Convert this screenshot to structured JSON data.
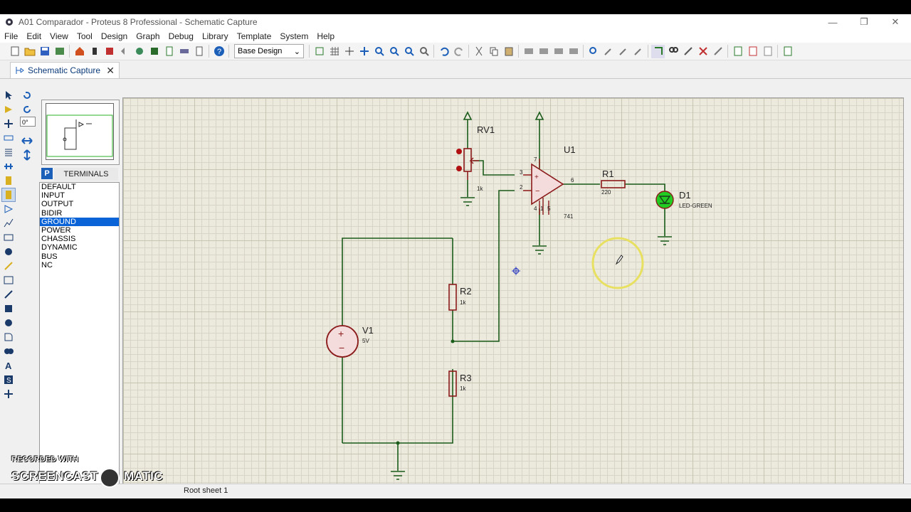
{
  "window": {
    "title": "A01 Comparador - Proteus 8 Professional - Schematic Capture",
    "controls": {
      "minimize": "—",
      "maximize": "❐",
      "close": "✕"
    }
  },
  "menu": [
    "File",
    "Edit",
    "View",
    "Tool",
    "Design",
    "Graph",
    "Debug",
    "Library",
    "Template",
    "System",
    "Help"
  ],
  "toolbar": {
    "design_select_value": "Base Design"
  },
  "tab": {
    "label": "Schematic Capture",
    "close": "✕"
  },
  "left_panel": {
    "angle_value": "0°",
    "pick_button": "P",
    "list_header": "TERMINALS",
    "terminals": [
      "DEFAULT",
      "INPUT",
      "OUTPUT",
      "BIDIR",
      "GROUND",
      "POWER",
      "CHASSIS",
      "DYNAMIC",
      "BUS",
      "NC"
    ],
    "selected_terminal": "GROUND"
  },
  "schematic": {
    "rv1": {
      "ref": "RV1",
      "value": "1k"
    },
    "u1": {
      "ref": "U1",
      "value": "741",
      "pins": {
        "noninv": "3",
        "inv": "2",
        "out": "6",
        "vplus": "7",
        "vminus": "4",
        "offset": "5",
        "offset2": "1"
      }
    },
    "r1": {
      "ref": "R1",
      "value": "220"
    },
    "d1": {
      "ref": "D1",
      "value": "LED-GREEN"
    },
    "r2": {
      "ref": "R2",
      "value": "1k"
    },
    "r3": {
      "ref": "R3",
      "value": "1k"
    },
    "v1": {
      "ref": "V1",
      "value": "5V"
    }
  },
  "status": {
    "sheet": "Root sheet 1"
  },
  "watermark": {
    "line1": "RECORDED WITH",
    "line2": "SCREENCAST",
    "line3": "MATIC"
  },
  "colors": {
    "wire": "#1a5c1a",
    "component": "#8b1a1a",
    "led": "#22cc22",
    "selection": "#0a64d8"
  }
}
